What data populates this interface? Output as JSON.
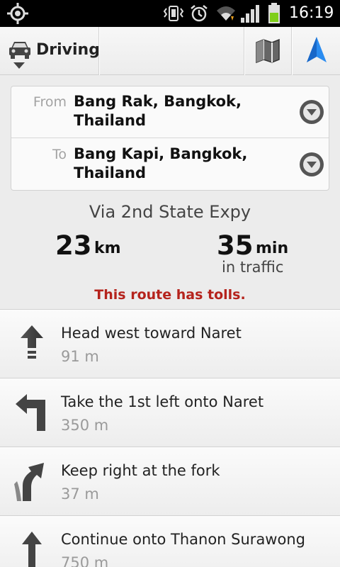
{
  "status_bar": {
    "time": "16:19",
    "icons": [
      "gps-icon",
      "vibrate-icon",
      "alarm-icon",
      "wifi-icon",
      "signal-icon",
      "battery-icon"
    ]
  },
  "action_bar": {
    "mode_label": "Driving",
    "mode_icon": "car-icon",
    "map_icon": "map-icon",
    "navigation_icon": "navigation-arrow-icon",
    "accent_color": "#1e7fe0"
  },
  "route": {
    "from_label": "From",
    "from_value": "Bang Rak, Bangkok, Thailand",
    "to_label": "To",
    "to_value": "Bang Kapi, Bangkok, Thailand"
  },
  "summary": {
    "via": "Via 2nd State Expy",
    "distance_value": "23",
    "distance_unit": "km",
    "time_value": "35",
    "time_unit": "min",
    "traffic_note": "in traffic",
    "tolls_warning": "This route has tolls.",
    "tolls_color": "#b5231c"
  },
  "steps": [
    {
      "icon": "straight-arrow-icon",
      "instruction": "Head west toward Naret",
      "distance": "91 m"
    },
    {
      "icon": "turn-left-icon",
      "instruction": "Take the 1st left onto Naret",
      "distance": "350 m"
    },
    {
      "icon": "keep-right-icon",
      "instruction": "Keep right at the fork",
      "distance": "37 m"
    },
    {
      "icon": "straight-arrow-icon",
      "instruction": "Continue onto Thanon Surawong",
      "distance": "750 m"
    }
  ]
}
